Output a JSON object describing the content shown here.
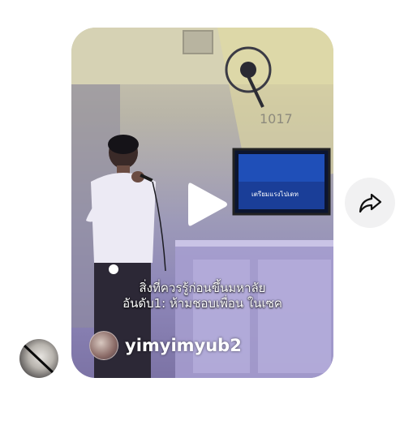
{
  "video": {
    "caption_line1": "สิ่งที่ควรรู้ก่อนขึ้นมหาลัย",
    "caption_line2": "อันดับ1: ห้ามชอบเพื่อน ในเซค",
    "room_number": "1017",
    "tv_text": "เตรียมแรงไปเดท",
    "play_icon": "play-icon"
  },
  "creator": {
    "username": "yimyimyub2",
    "avatar_icon": "creator-avatar"
  },
  "actions": {
    "share_icon": "share-arrow-icon"
  },
  "viewer": {
    "avatar_icon": "user-avatar"
  }
}
